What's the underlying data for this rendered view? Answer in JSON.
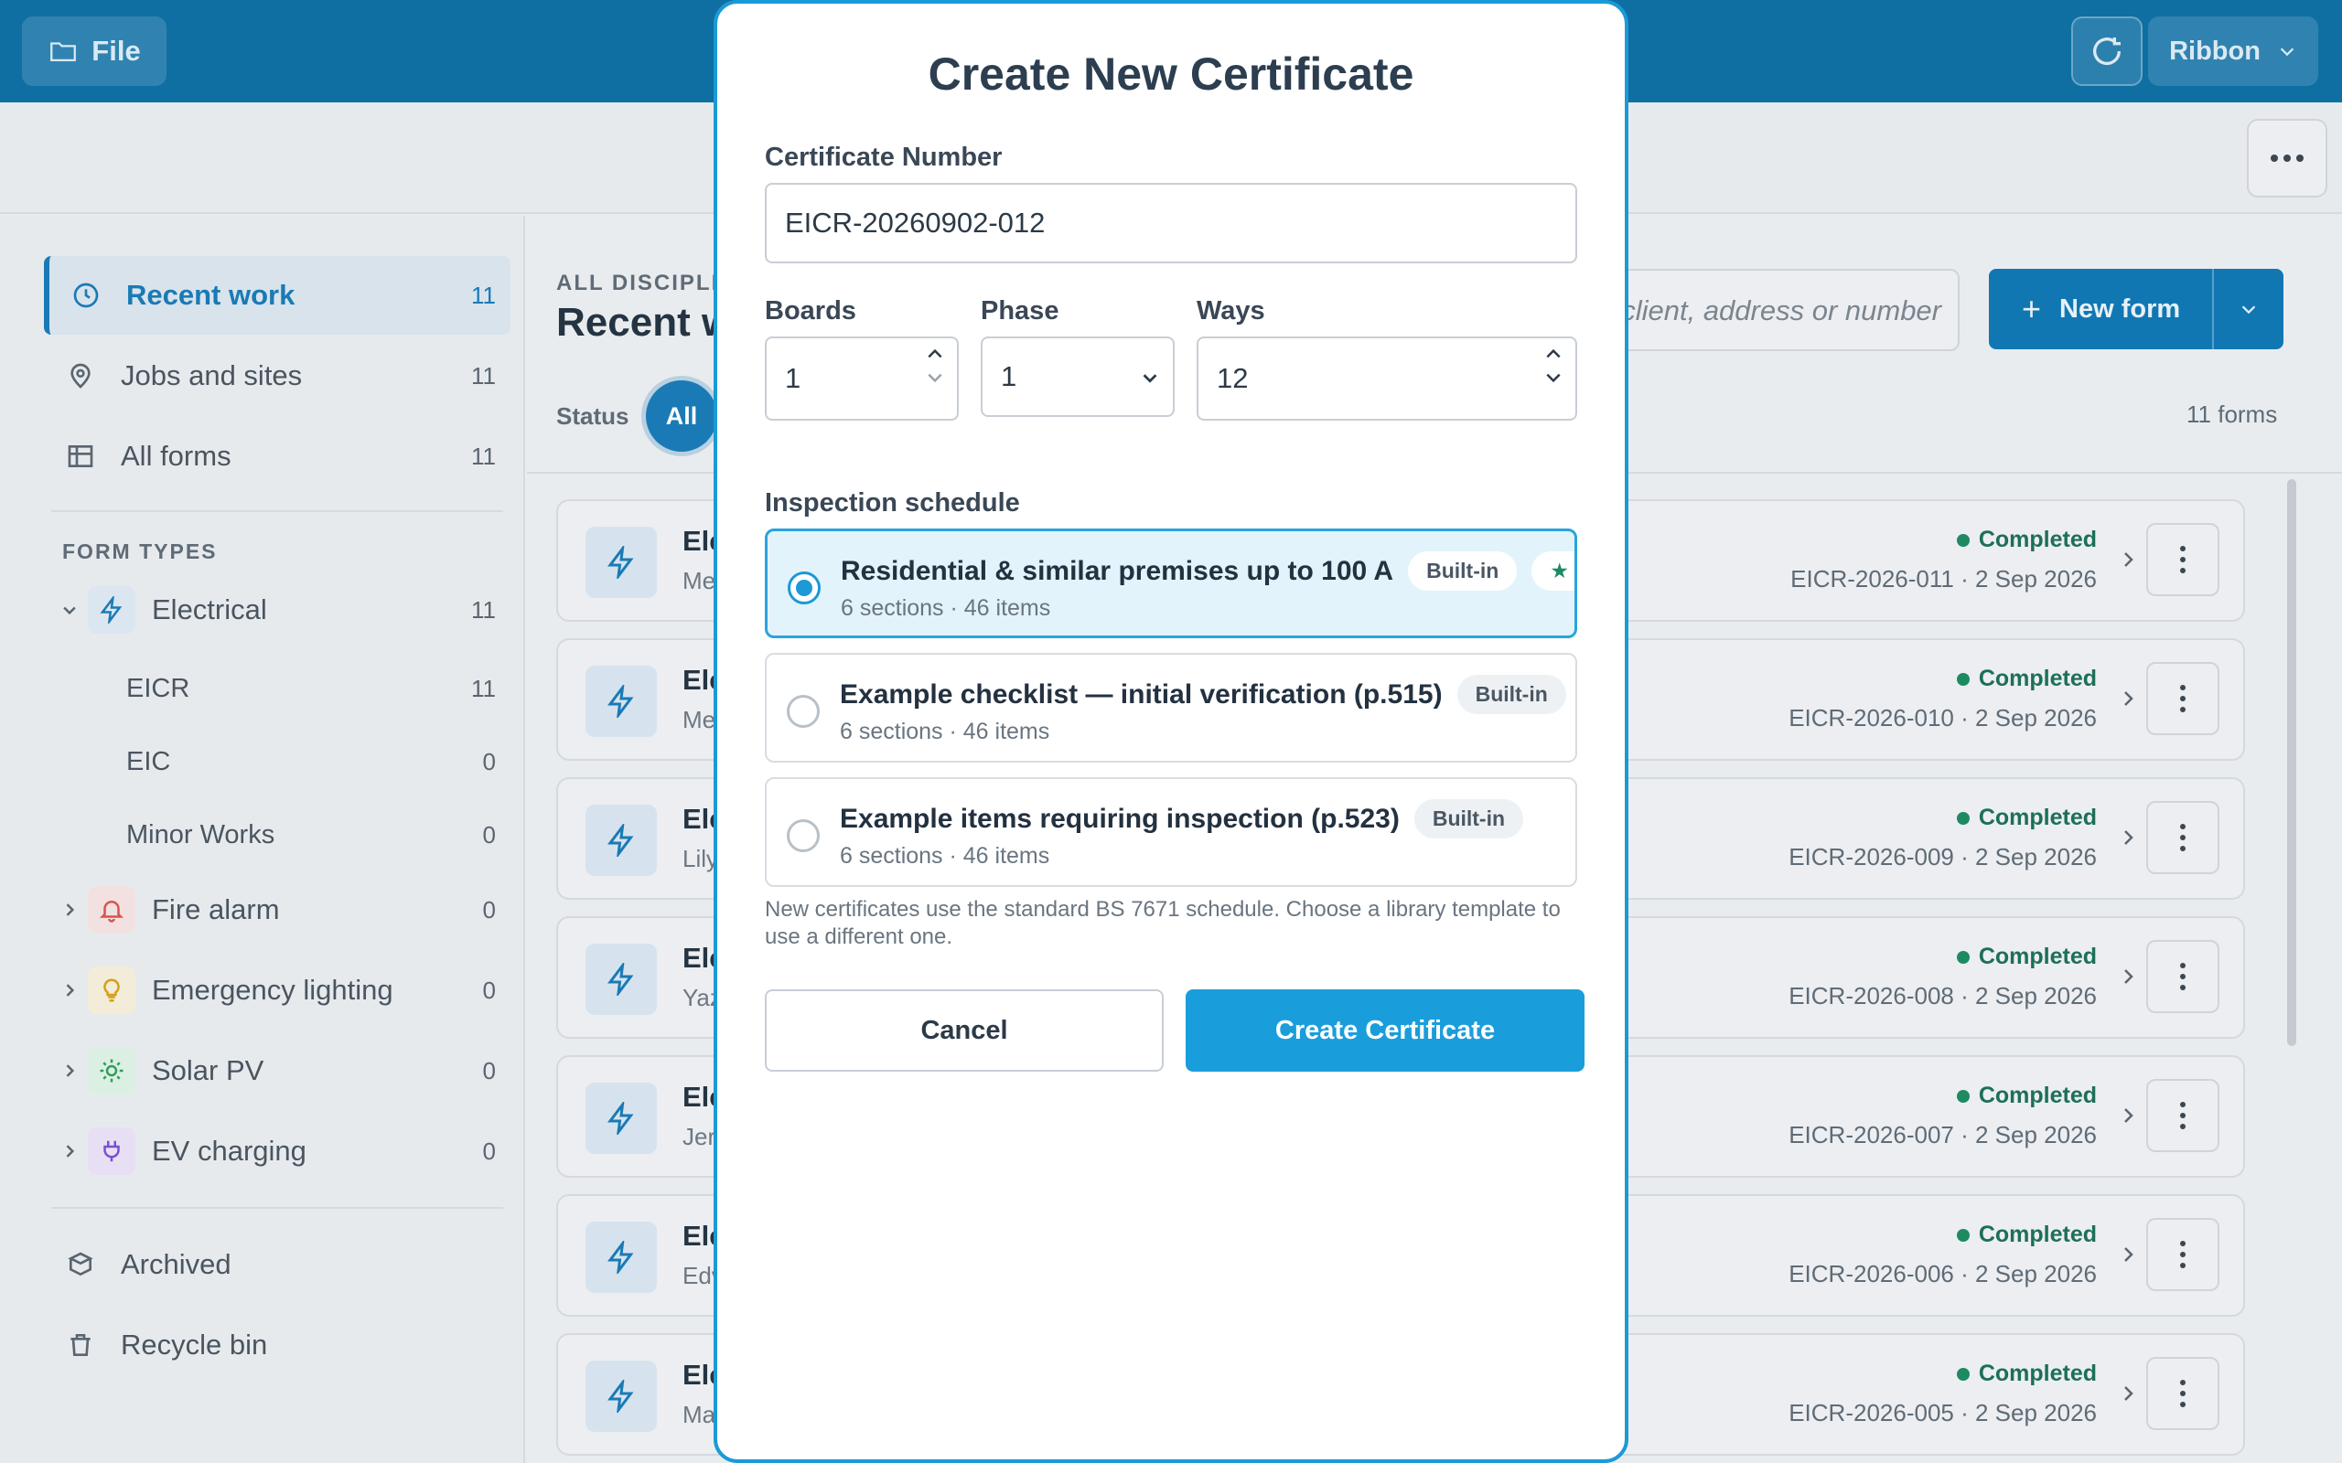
{
  "topbar": {
    "file_label": "File",
    "ribbon_label": "Ribbon"
  },
  "sidebar": {
    "items": [
      {
        "label": "Recent work",
        "count": "11",
        "icon": "clock-icon"
      },
      {
        "label": "Jobs and sites",
        "count": "11",
        "icon": "map-pin-icon"
      },
      {
        "label": "All forms",
        "count": "11",
        "icon": "table-icon"
      }
    ],
    "form_types_heading": "FORM TYPES",
    "types": [
      {
        "label": "Electrical",
        "count": "11",
        "icon": "lightning-icon",
        "color": "#1a7ab5"
      },
      {
        "label": "Fire alarm",
        "count": "0",
        "icon": "bell-icon",
        "color": "#d9534f"
      },
      {
        "label": "Emergency lighting",
        "count": "0",
        "icon": "lightbulb-icon",
        "color": "#d4a017"
      },
      {
        "label": "Solar PV",
        "count": "0",
        "icon": "sun-icon",
        "color": "#2e9e5b"
      },
      {
        "label": "EV charging",
        "count": "0",
        "icon": "plug-icon",
        "color": "#7b4fd0"
      }
    ],
    "subtypes": [
      {
        "label": "EICR",
        "count": "11"
      },
      {
        "label": "EIC",
        "count": "0"
      },
      {
        "label": "Minor Works",
        "count": "0"
      }
    ],
    "archived": "Archived",
    "recycle": "Recycle bin"
  },
  "main": {
    "discipline_label": "ALL DISCIPLIN",
    "title": "Recent w",
    "status_label": "Status",
    "status_chip": "All",
    "search_placeholder": "client, address or number",
    "new_form": "New form",
    "forms_count": "11  forms",
    "rows": [
      {
        "title": "Ele",
        "sub": "Me",
        "status": "Completed",
        "number": "EICR-2026-011",
        "date": "2 Sep 2026"
      },
      {
        "title": "Ele",
        "sub": "Me",
        "status": "Completed",
        "number": "EICR-2026-010",
        "date": "2 Sep 2026"
      },
      {
        "title": "Ele",
        "sub": "Lily",
        "status": "Completed",
        "number": "EICR-2026-009",
        "date": "2 Sep 2026"
      },
      {
        "title": "Ele",
        "sub": "Yaz",
        "status": "Completed",
        "number": "EICR-2026-008",
        "date": "2 Sep 2026"
      },
      {
        "title": "Ele",
        "sub": "Jer",
        "status": "Completed",
        "number": "EICR-2026-007",
        "date": "2 Sep 2026"
      },
      {
        "title": "Ele",
        "sub": "Edv",
        "status": "Completed",
        "number": "EICR-2026-006",
        "date": "2 Sep 2026"
      },
      {
        "title": "Ele",
        "sub": "Ma",
        "status": "Completed",
        "number": "EICR-2026-005",
        "date": "2 Sep 2026"
      }
    ]
  },
  "modal": {
    "title": "Create New Certificate",
    "cert_label": "Certificate Number",
    "cert_value": "EICR-20260902-012",
    "boards_label": "Boards",
    "boards_value": "1",
    "phase_label": "Phase",
    "phase_value": "1",
    "ways_label": "Ways",
    "ways_value": "12",
    "schedule_label": "Inspection schedule",
    "options": [
      {
        "title": "Residential & similar premises up to 100 A",
        "badge": "Built-in",
        "default_badge": "★ Default",
        "sub": "6 sections · 46 items",
        "selected": true
      },
      {
        "title": "Example checklist — initial verification (p.515)",
        "badge": "Built-in",
        "sub": "6 sections · 46 items",
        "selected": false
      },
      {
        "title": "Example items requiring inspection (p.523)",
        "badge": "Built-in",
        "sub": "6 sections · 46 items",
        "selected": false
      }
    ],
    "note": "New certificates use the standard BS 7671 schedule. Choose a library template to use a different one.",
    "cancel": "Cancel",
    "create": "Create Certificate"
  },
  "colors": {
    "brand": "#0f6fa3",
    "accent": "#1a9ddb",
    "completed": "#1d8a62"
  }
}
